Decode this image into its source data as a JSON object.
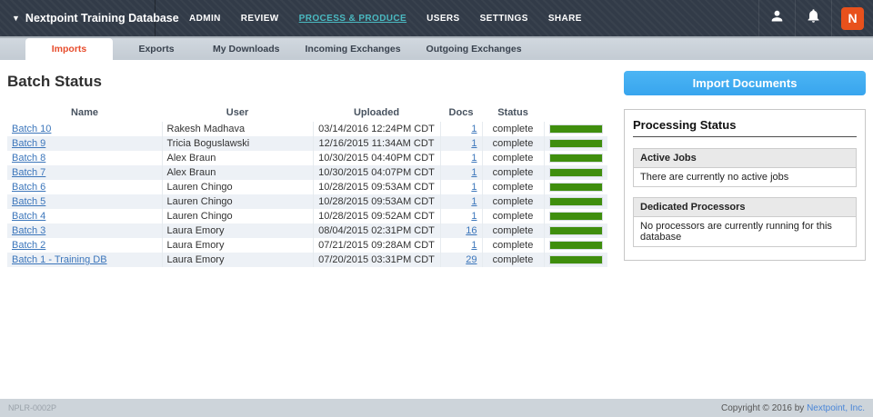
{
  "navbar": {
    "caret": "▼",
    "brand": "Nextpoint Training Database",
    "links": [
      {
        "label": "ADMIN",
        "active": false
      },
      {
        "label": "REVIEW",
        "active": false
      },
      {
        "label": "PROCESS & PRODUCE",
        "active": true
      },
      {
        "label": "USERS",
        "active": false
      },
      {
        "label": "SETTINGS",
        "active": false
      },
      {
        "label": "SHARE",
        "active": false
      }
    ],
    "logo_letter": "N"
  },
  "tabs": [
    {
      "label": "Imports",
      "active": true
    },
    {
      "label": "Exports",
      "active": false
    },
    {
      "label": "My Downloads",
      "active": false
    },
    {
      "label": "Incoming Exchanges",
      "active": false
    },
    {
      "label": "Outgoing Exchanges",
      "active": false
    }
  ],
  "main": {
    "title": "Batch Status",
    "table": {
      "headers": {
        "name": "Name",
        "user": "User",
        "uploaded": "Uploaded",
        "docs": "Docs",
        "status": "Status"
      },
      "rows": [
        {
          "name": "Batch 10",
          "user": "Rakesh Madhava",
          "uploaded": "03/14/2016 12:24PM CDT",
          "docs": "1",
          "status": "complete",
          "progress": 100
        },
        {
          "name": "Batch 9",
          "user": "Tricia Boguslawski",
          "uploaded": "12/16/2015 11:34AM CDT",
          "docs": "1",
          "status": "complete",
          "progress": 100
        },
        {
          "name": "Batch 8",
          "user": "Alex Braun",
          "uploaded": "10/30/2015 04:40PM CDT",
          "docs": "1",
          "status": "complete",
          "progress": 100
        },
        {
          "name": "Batch 7",
          "user": "Alex Braun",
          "uploaded": "10/30/2015 04:07PM CDT",
          "docs": "1",
          "status": "complete",
          "progress": 100
        },
        {
          "name": "Batch 6",
          "user": "Lauren Chingo",
          "uploaded": "10/28/2015 09:53AM CDT",
          "docs": "1",
          "status": "complete",
          "progress": 100
        },
        {
          "name": "Batch 5",
          "user": "Lauren Chingo",
          "uploaded": "10/28/2015 09:53AM CDT",
          "docs": "1",
          "status": "complete",
          "progress": 100
        },
        {
          "name": "Batch 4",
          "user": "Lauren Chingo",
          "uploaded": "10/28/2015 09:52AM CDT",
          "docs": "1",
          "status": "complete",
          "progress": 100
        },
        {
          "name": "Batch 3",
          "user": "Laura Emory",
          "uploaded": "08/04/2015 02:31PM CDT",
          "docs": "16",
          "status": "complete",
          "progress": 100
        },
        {
          "name": "Batch 2",
          "user": "Laura Emory",
          "uploaded": "07/21/2015 09:28AM CDT",
          "docs": "1",
          "status": "complete",
          "progress": 100
        },
        {
          "name": "Batch 1 - Training DB",
          "user": "Laura Emory",
          "uploaded": "07/20/2015 03:31PM CDT",
          "docs": "29",
          "status": "complete",
          "progress": 100
        }
      ]
    }
  },
  "side": {
    "import_button": "Import Documents",
    "processing_status": {
      "title": "Processing Status",
      "sections": [
        {
          "header": "Active Jobs",
          "body": "There are currently no active jobs"
        },
        {
          "header": "Dedicated Processors",
          "body": "No processors are currently running for this database"
        }
      ]
    }
  },
  "footer": {
    "left": "NPLR-0002P",
    "copyright_prefix": "Copyright © 2016 by ",
    "copyright_link": "Nextpoint, Inc."
  },
  "colors": {
    "accent_orange": "#e74c2c",
    "nav_active_teal": "#4ab9c1",
    "progress_green": "#3f8e0d",
    "button_blue": "#3fadf2",
    "link_blue": "#3c76bb",
    "footer_link_blue": "#4a86d8",
    "brand_logo_orange": "#e8511c"
  }
}
